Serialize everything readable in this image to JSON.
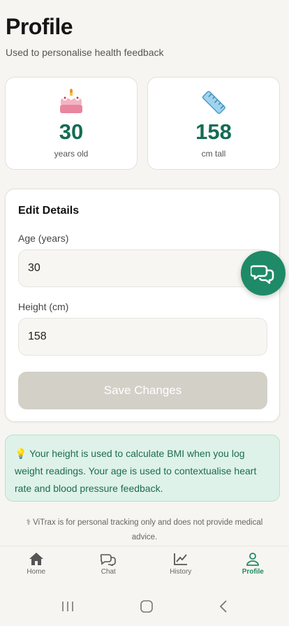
{
  "header": {
    "title": "Profile",
    "subtitle": "Used to personalise health feedback"
  },
  "stats": {
    "age": {
      "icon": "birthday-cake-icon",
      "value": "30",
      "label": "years old"
    },
    "height": {
      "icon": "ruler-icon",
      "value": "158",
      "label": "cm tall"
    }
  },
  "edit": {
    "title": "Edit Details",
    "age_label": "Age (years)",
    "age_value": "30",
    "height_label": "Height (cm)",
    "height_value": "158",
    "save_label": "Save Changes"
  },
  "info": {
    "text": "💡 Your height is used to calculate BMI when you log weight readings. Your age is used to contextualise heart rate and blood pressure feedback."
  },
  "disclaimer": "⚕ ViTrax is for personal tracking only and does not provide medical advice.",
  "nav": [
    {
      "label": "Home",
      "icon": "home-icon",
      "active": false
    },
    {
      "label": "Chat",
      "icon": "chat-icon",
      "active": false
    },
    {
      "label": "History",
      "icon": "chart-icon",
      "active": false
    },
    {
      "label": "Profile",
      "icon": "person-icon",
      "active": true
    }
  ],
  "colors": {
    "accent": "#1f8a67",
    "value_text": "#146c54",
    "info_bg": "#def2ea",
    "save_disabled": "#d3d0c8"
  }
}
